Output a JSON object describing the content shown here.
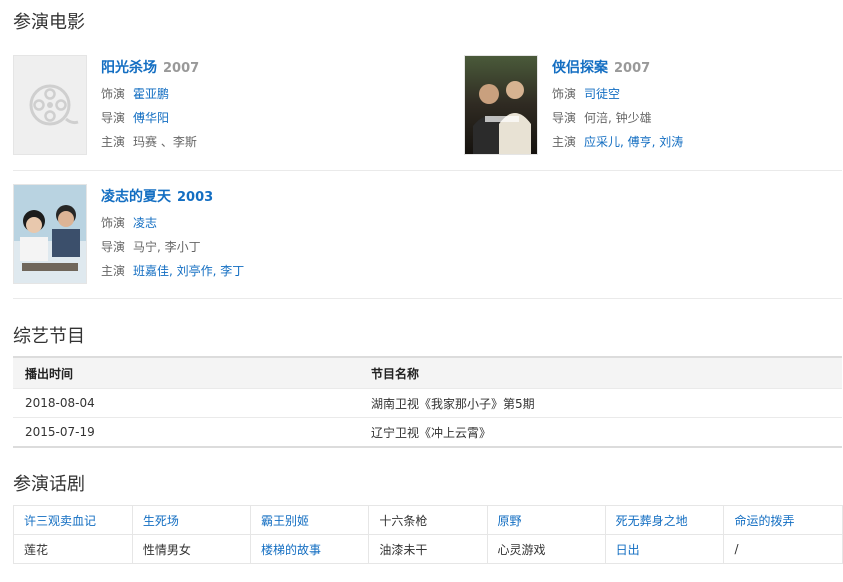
{
  "movies_section": {
    "title": "参演电影",
    "movies": [
      {
        "title": "阳光杀场",
        "year": "2007",
        "rows": [
          {
            "label": "饰演",
            "value": "霍亚鹏",
            "link": true
          },
          {
            "label": "导演",
            "value": "傅华阳",
            "link": true
          },
          {
            "label": "主演",
            "value": "玛赛 、李斯",
            "link": false
          }
        ],
        "poster": "film-reel-placeholder-icon"
      },
      {
        "title": "侠侣探案",
        "year": "2007",
        "rows": [
          {
            "label": "饰演",
            "value": "司徒空",
            "link": true
          },
          {
            "label": "导演",
            "value": "何涪, 钟少雄",
            "link": false
          },
          {
            "label": "主演",
            "value": "应采儿, 傅亨, 刘涛",
            "link": true
          }
        ],
        "poster": "movie-poster"
      },
      {
        "title": "凌志的夏天",
        "year": "2003",
        "rows": [
          {
            "label": "饰演",
            "value": "凌志",
            "link": true
          },
          {
            "label": "导演",
            "value": "马宁, 李小丁",
            "link": false
          },
          {
            "label": "主演",
            "value": "班嘉佳, 刘亭作, 李丁",
            "link": true
          }
        ],
        "poster": "movie-poster"
      }
    ]
  },
  "variety_section": {
    "title": "综艺节目",
    "headers": [
      "播出时间",
      "节目名称"
    ],
    "rows": [
      [
        "2018-08-04",
        "湖南卫视《我家那小子》第5期"
      ],
      [
        "2015-07-19",
        "辽宁卫视《冲上云霄》"
      ]
    ]
  },
  "drama_section": {
    "title": "参演话剧",
    "rows": [
      [
        {
          "text": "许三观卖血记",
          "link": true
        },
        {
          "text": "生死场",
          "link": true
        },
        {
          "text": "霸王别姬",
          "link": true
        },
        {
          "text": "十六条枪",
          "link": false
        },
        {
          "text": "原野",
          "link": true
        },
        {
          "text": "死无葬身之地",
          "link": true
        },
        {
          "text": "命运的拨弄",
          "link": true
        }
      ],
      [
        {
          "text": "莲花",
          "link": false
        },
        {
          "text": "性情男女",
          "link": false
        },
        {
          "text": "楼梯的故事",
          "link": true
        },
        {
          "text": "油漆未干",
          "link": false
        },
        {
          "text": "心灵游戏",
          "link": false
        },
        {
          "text": "日出",
          "link": true
        },
        {
          "text": "/",
          "link": false
        }
      ]
    ]
  },
  "colors": {
    "link": "#136ec2",
    "muted": "#999999",
    "text": "#333333"
  }
}
